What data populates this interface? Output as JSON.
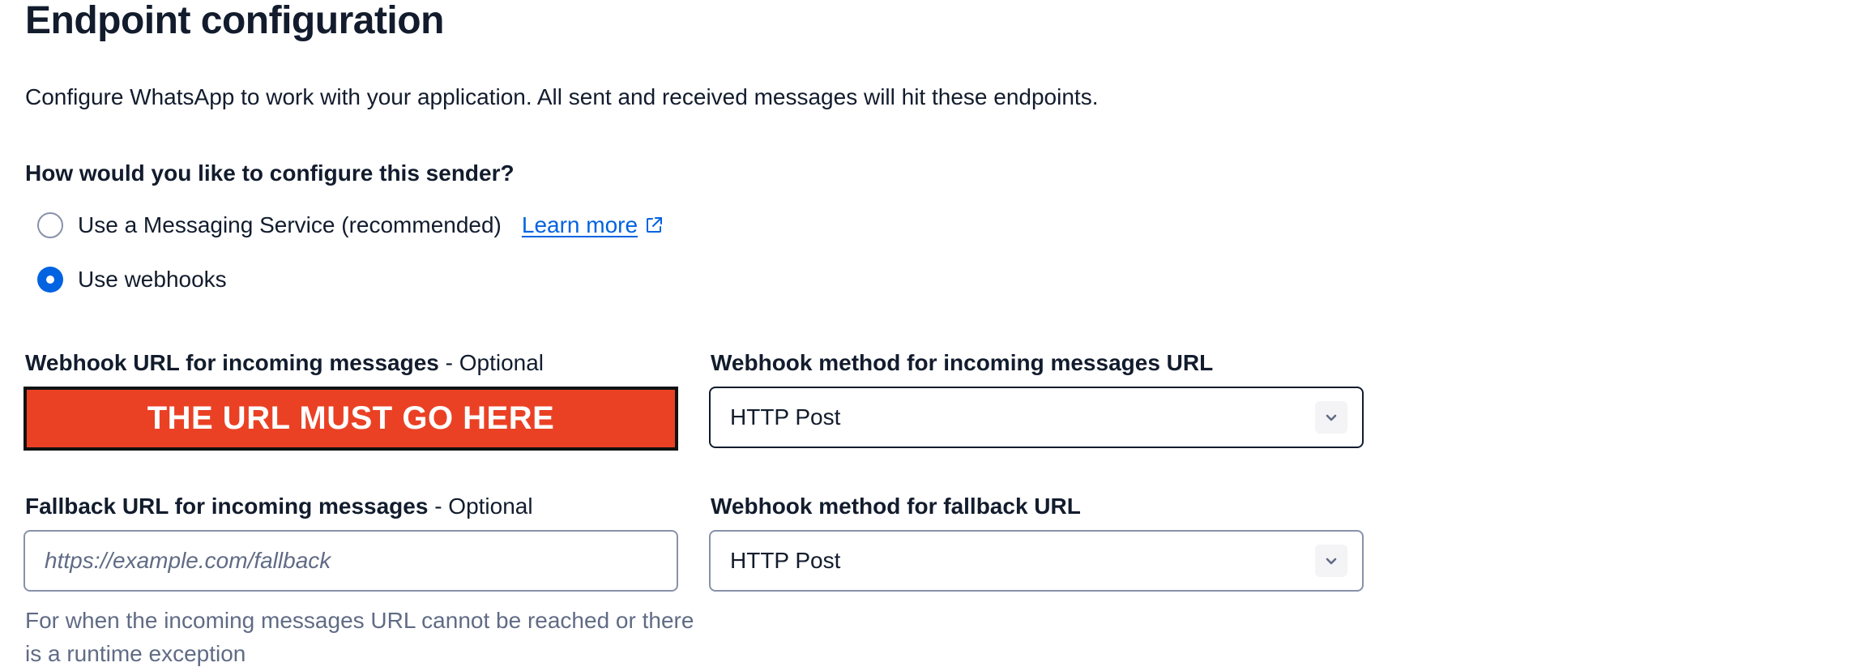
{
  "page": {
    "title": "Endpoint configuration",
    "description": "Configure WhatsApp to work with your application. All sent and received messages will hit these endpoints."
  },
  "sender_config": {
    "question": "How would you like to configure this sender?",
    "options": [
      {
        "label": "Use a Messaging Service (recommended)",
        "checked": false
      },
      {
        "label": "Use webhooks",
        "checked": true
      }
    ],
    "learn_more": "Learn more",
    "learn_more_icon": "external-link-icon"
  },
  "webhook_url": {
    "label": "Webhook URL for incoming messages",
    "optional": " - Optional",
    "banner_text": "THE URL MUST GO HERE",
    "banner_color": "#ea4125"
  },
  "webhook_method": {
    "label": "Webhook method for incoming messages URL",
    "value": "HTTP Post",
    "icon": "chevron-down-icon"
  },
  "fallback_url": {
    "label": "Fallback URL for incoming messages",
    "optional": " - Optional",
    "placeholder": "https://example.com/fallback",
    "value": "",
    "help": "For when the incoming messages URL cannot be reached or there is a runtime exception"
  },
  "fallback_method": {
    "label": "Webhook method for fallback URL",
    "value": "HTTP Post",
    "icon": "chevron-down-icon"
  },
  "colors": {
    "text": "#121c2d",
    "link": "#0263e0",
    "radio_checked": "#0263e0",
    "border": "#8891aa",
    "help_text": "#606b85"
  }
}
